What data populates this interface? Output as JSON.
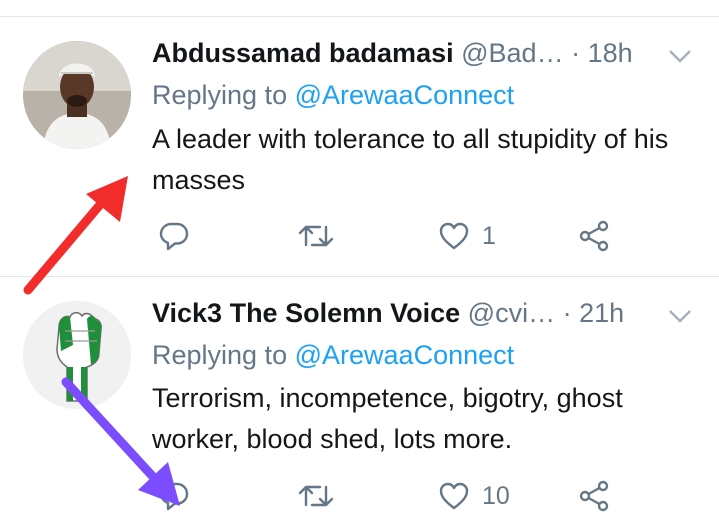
{
  "colors": {
    "accent": "#1da1f2",
    "text": "#14171a",
    "muted": "#657786",
    "divider": "#e1e8ed",
    "annotation_red": "#f22b2b",
    "annotation_purple": "#7b4dff"
  },
  "tweets": [
    {
      "name": "Abdussamad badamasi",
      "handle": "@Bad…",
      "separator": "·",
      "time": "18h",
      "reply_prefix": "Replying to",
      "reply_to": "@ArewaaConnect",
      "text": "A leader with tolerance to all stupidity of his masses",
      "reply_icon": "reply-icon",
      "retweet_icon": "retweet-icon",
      "like_icon": "like-icon",
      "like_count": "1",
      "share_icon": "share-icon"
    },
    {
      "name": "Vick3 The Solemn Voice",
      "handle": "@cvi…",
      "separator": "·",
      "time": "21h",
      "reply_prefix": "Replying to",
      "reply_to": "@ArewaaConnect",
      "text": "Terrorism, incompetence, bigotry, ghost worker, blood shed, lots more.",
      "reply_icon": "reply-icon",
      "retweet_icon": "retweet-icon",
      "like_icon": "like-icon",
      "like_count": "10",
      "share_icon": "share-icon"
    }
  ]
}
